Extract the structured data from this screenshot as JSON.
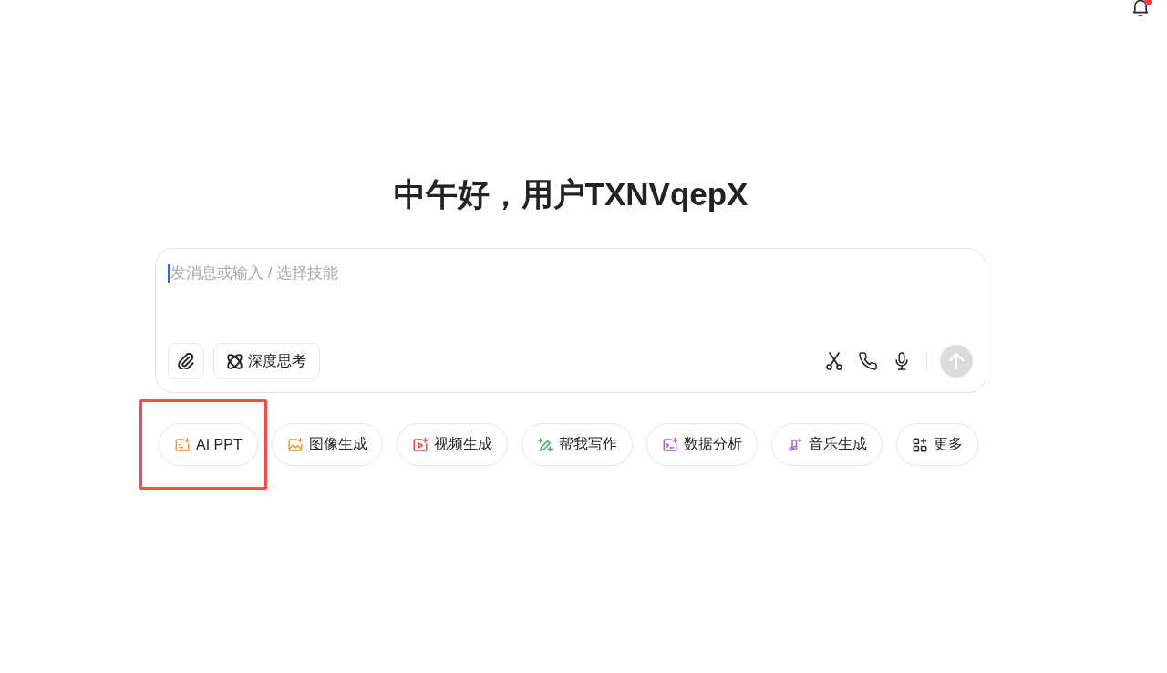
{
  "notifications": {
    "unread": true
  },
  "greeting": "中午好，用户TXNVqepX",
  "composer": {
    "input": {
      "placeholder": "发消息或输入 / 选择技能",
      "focused": true
    },
    "deep_think": {
      "label": "深度思考",
      "on": false
    },
    "send": {
      "disabled": true
    }
  },
  "skills": [
    {
      "label": "AI PPT",
      "kind": "slides",
      "color": "#f5961f",
      "highlighted": true
    },
    {
      "label": "图像生成",
      "kind": "image",
      "color": "#f5961f",
      "highlighted": false
    },
    {
      "label": "视频生成",
      "kind": "video",
      "color": "#f03c3c",
      "highlighted": false
    },
    {
      "label": "帮我写作",
      "kind": "write",
      "color": "#34b35a",
      "highlighted": false
    },
    {
      "label": "数据分析",
      "kind": "data",
      "color": "#9b5de5",
      "highlighted": false
    },
    {
      "label": "音乐生成",
      "kind": "music",
      "color": "#9b5de5",
      "highlighted": false
    },
    {
      "label": "更多",
      "kind": "more",
      "color": "#222222",
      "highlighted": false
    }
  ]
}
